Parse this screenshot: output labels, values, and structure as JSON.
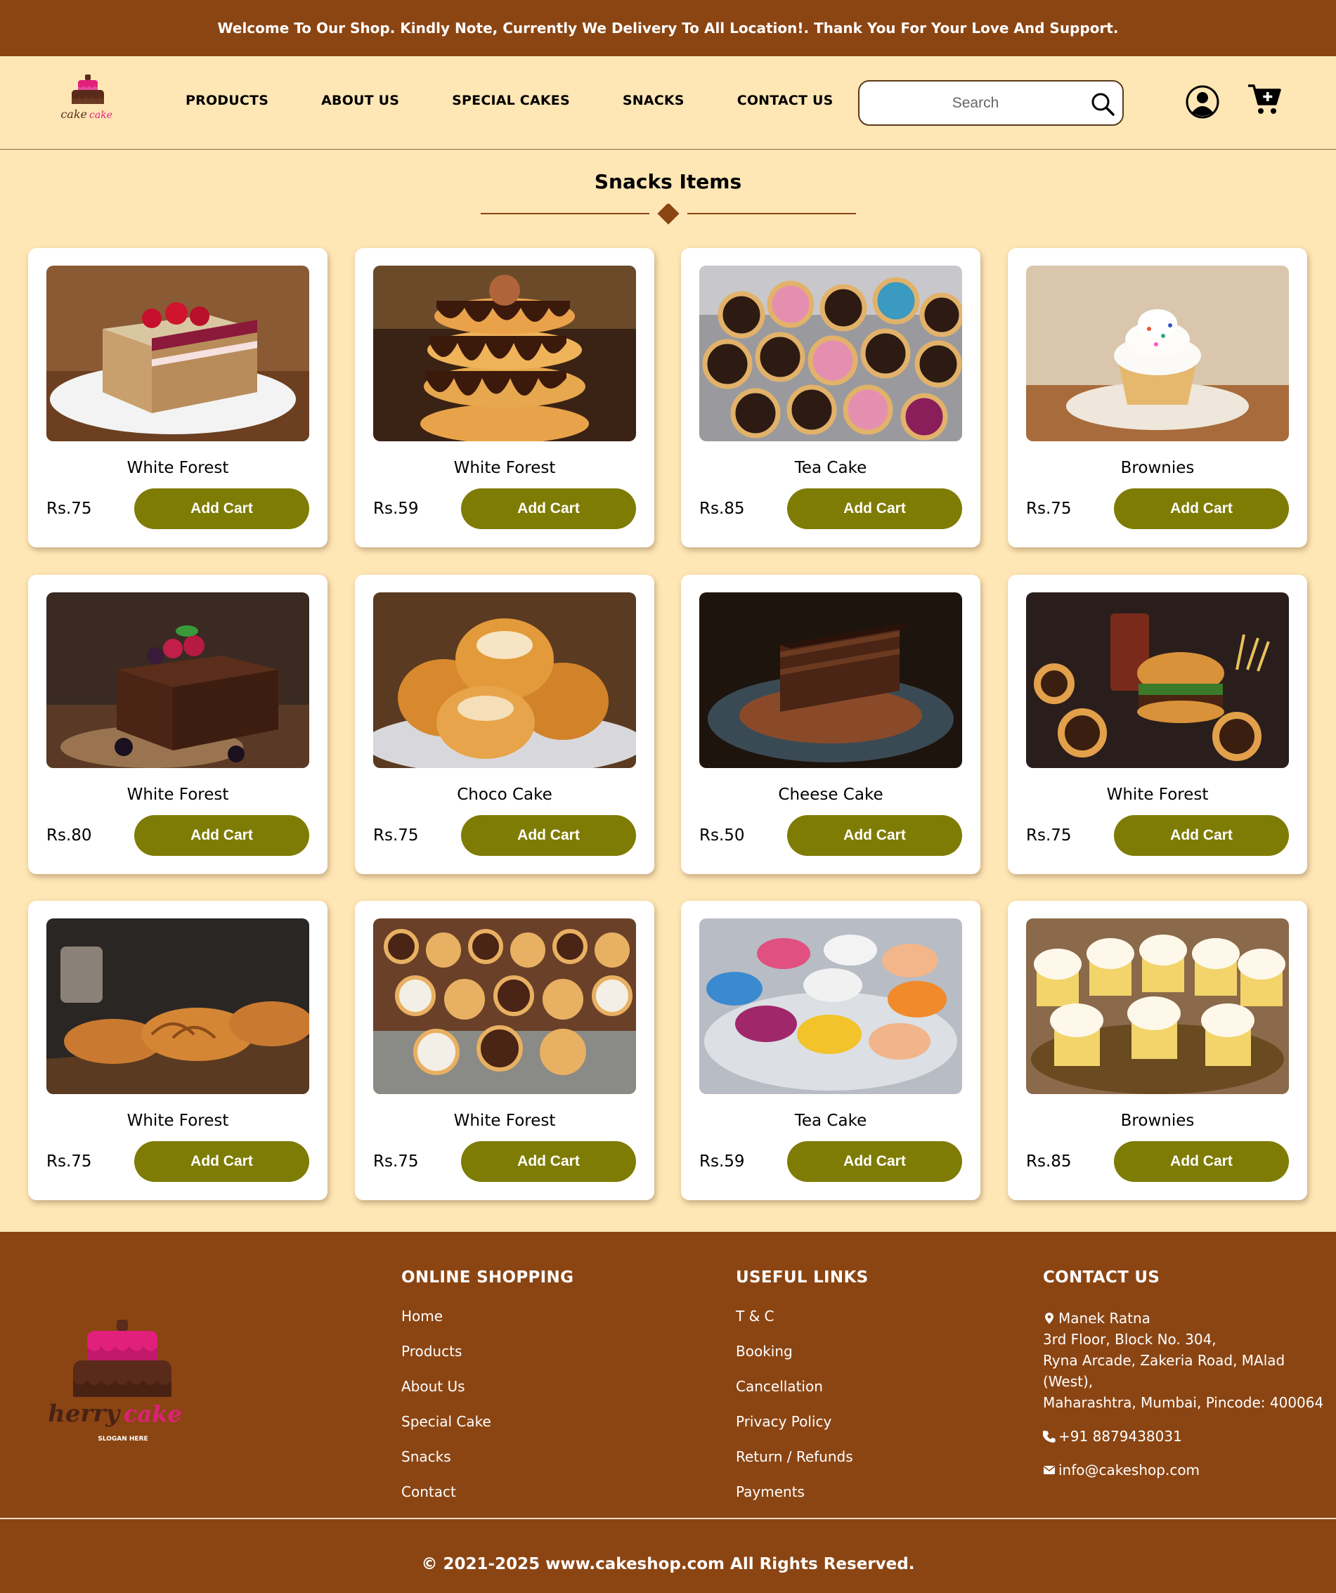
{
  "announcement": "Welcome To Our Shop. Kindly Note, Currently We Delivery To All Location!. Thank You For Your Love And Support.",
  "brand": {
    "name": "cherry cake",
    "slogan": "SLOGAN HERE"
  },
  "nav": [
    "PRODUCTS",
    "ABOUT US",
    "SPECIAL CAKES",
    "SNACKS",
    "CONTACT US"
  ],
  "search": {
    "placeholder": "Search"
  },
  "section": {
    "title": "Snacks Items"
  },
  "colors": {
    "brown": "#8b4513",
    "cream": "#ffe6b5",
    "button": "#7e7c04"
  },
  "products": [
    {
      "name": "White Forest",
      "price": "Rs.75",
      "button": "Add Cart",
      "image": "layered-berry-cake"
    },
    {
      "name": "White Forest",
      "price": "Rs.59",
      "button": "Add Cart",
      "image": "stacked-chocolate-donuts"
    },
    {
      "name": "Tea Cake",
      "price": "Rs.85",
      "button": "Add Cart",
      "image": "assorted-donuts"
    },
    {
      "name": "Brownies",
      "price": "Rs.75",
      "button": "Add Cart",
      "image": "frosted-cupcake"
    },
    {
      "name": "White Forest",
      "price": "Rs.80",
      "button": "Add Cart",
      "image": "chocolate-berry-cake"
    },
    {
      "name": "Choco Cake",
      "price": "Rs.75",
      "button": "Add Cart",
      "image": "sugar-buns"
    },
    {
      "name": "Cheese Cake",
      "price": "Rs.50",
      "button": "Add Cart",
      "image": "chocolate-cake-slice"
    },
    {
      "name": "White Forest",
      "price": "Rs.75",
      "button": "Add Cart",
      "image": "burger-and-donuts"
    },
    {
      "name": "White Forest",
      "price": "Rs.75",
      "button": "Add Cart",
      "image": "croissants"
    },
    {
      "name": "White Forest",
      "price": "Rs.75",
      "button": "Add Cart",
      "image": "assorted-cookies"
    },
    {
      "name": "Tea Cake",
      "price": "Rs.59",
      "button": "Add Cart",
      "image": "macarons"
    },
    {
      "name": "Brownies",
      "price": "Rs.85",
      "button": "Add Cart",
      "image": "vanilla-cupcakes"
    }
  ],
  "footer": {
    "online_shopping": {
      "title": "ONLINE SHOPPING",
      "links": [
        "Home",
        "Products",
        "About Us",
        "Special Cake",
        "Snacks",
        "Contact"
      ]
    },
    "useful_links": {
      "title": "USEFUL LINKS",
      "links": [
        "T & C",
        "Booking",
        "Cancellation",
        "Privacy Policy",
        "Return / Refunds",
        "Payments"
      ]
    },
    "contact": {
      "title": "CONTACT US",
      "address": [
        "Manek Ratna",
        "3rd Floor, Block No. 304,",
        "Ryna Arcade, Zakeria Road, MAlad (West),",
        "Maharashtra, Mumbai, Pincode: 400064"
      ],
      "phone": "+91 8879438031",
      "email": "info@cakeshop.com"
    },
    "copyright": "© 2021-2025 www.cakeshop.com All Rights Reserved."
  }
}
